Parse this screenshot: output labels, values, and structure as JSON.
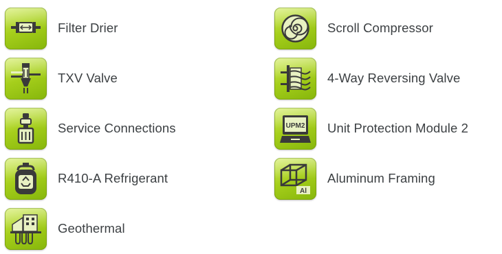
{
  "features": {
    "left": [
      {
        "label": "Filter Drier",
        "icon": "filter-drier-icon"
      },
      {
        "label": "TXV Valve",
        "icon": "txv-valve-icon"
      },
      {
        "label": "Service Connections",
        "icon": "service-connections-icon"
      },
      {
        "label": "R410-A Refrigerant",
        "icon": "refrigerant-tank-icon"
      },
      {
        "label": "Geothermal",
        "icon": "geothermal-icon"
      }
    ],
    "right": [
      {
        "label": "Scroll Compressor",
        "icon": "scroll-compressor-icon"
      },
      {
        "label": "4-Way Reversing Valve",
        "icon": "reversing-valve-icon"
      },
      {
        "label": "Unit Protection Module 2",
        "icon": "upm2-icon",
        "icon_text": "UPM2"
      },
      {
        "label": "Aluminum Framing",
        "icon": "aluminum-framing-icon",
        "icon_text": "Al"
      }
    ]
  },
  "colors": {
    "tile_light": "#d6ee6a",
    "tile_mid": "#a6cf1c",
    "tile_dark": "#86b60b",
    "glyph": "#3a3a3a",
    "label_text": "#3c4043",
    "background": "#ffffff"
  }
}
